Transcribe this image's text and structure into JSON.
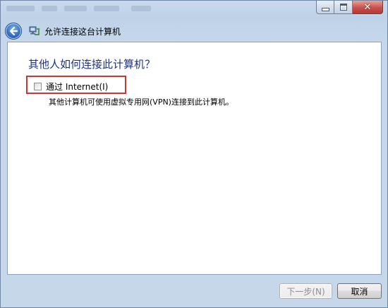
{
  "window": {
    "caption_buttons": {
      "minimize_icon": "minimize-icon",
      "maximize_icon": "maximize-icon",
      "close_glyph": "✕"
    }
  },
  "nav": {
    "back_icon": "back-arrow-icon",
    "wizard_icon": "network-computer-icon",
    "title": "允许连接这台计算机"
  },
  "content": {
    "heading": "其他人如何连接此计算机？",
    "option": {
      "label": "通过 Internet(I)",
      "checked": false
    },
    "description": "其他计算机可使用虚拟专用网(VPN)连接到此计算机。"
  },
  "buttons": {
    "next": "下一步(N)",
    "cancel": "取消"
  },
  "colors": {
    "heading": "#1e3287",
    "highlight_border": "#d9302c"
  }
}
